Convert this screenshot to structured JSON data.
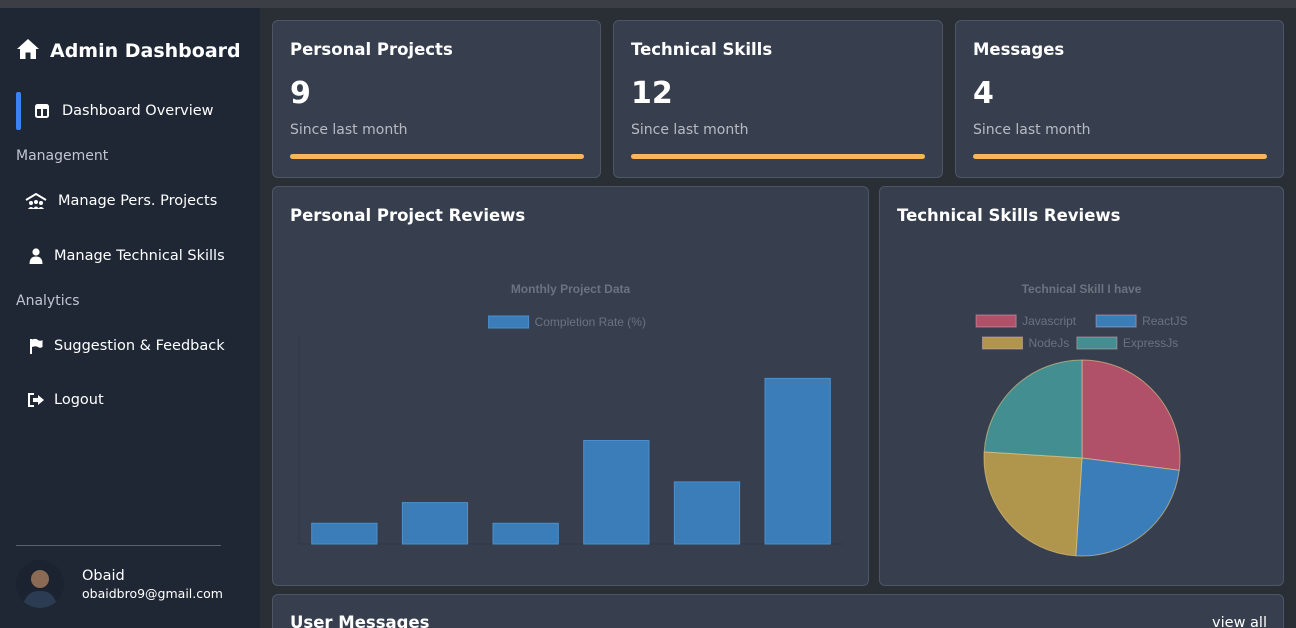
{
  "sidebar": {
    "title": "Admin Dashboard",
    "items": [
      {
        "label": "Dashboard Overview"
      },
      {
        "label": "Manage Pers. Projects"
      },
      {
        "label": "Manage Technical Skills"
      },
      {
        "label": "Suggestion & Feedback"
      },
      {
        "label": "Logout"
      }
    ],
    "sections": {
      "management": "Management",
      "analytics": "Analytics"
    },
    "user": {
      "name": "Obaid",
      "email": "obaidbro9@gmail.com"
    }
  },
  "stats": [
    {
      "title": "Personal Projects",
      "value": "9",
      "subtitle": "Since last month",
      "progress": 1.0
    },
    {
      "title": "Technical Skills",
      "value": "12",
      "subtitle": "Since last month",
      "progress": 1.0
    },
    {
      "title": "Messages",
      "value": "4",
      "subtitle": "Since last month",
      "progress": 1.0
    }
  ],
  "colors": {
    "accent": "#3b82f6",
    "progress": "#f8b55a",
    "bar": "#3a7db8"
  },
  "panels": {
    "project_reviews": {
      "title": "Personal Project Reviews"
    },
    "skill_reviews": {
      "title": "Technical Skills Reviews"
    },
    "messages": {
      "title": "User Messages",
      "view_all": "view all"
    }
  },
  "chart_data": [
    {
      "type": "bar",
      "title": "Monthly Project Data",
      "categories": [
        "",
        "",
        "",
        "",
        "",
        ""
      ],
      "series": [
        {
          "name": "Completion Rate (%)",
          "values": [
            10,
            20,
            10,
            50,
            30,
            80
          ]
        }
      ],
      "ylim": [
        0,
        100
      ],
      "grid": false,
      "legend": "top"
    },
    {
      "type": "pie",
      "title": "Technical Skill I have",
      "labels": [
        "Javascript",
        "ReactJS",
        "NodeJs",
        "ExpressJs"
      ],
      "values": [
        27,
        24,
        25,
        24
      ],
      "colors": [
        "#b05069",
        "#3a7db8",
        "#b0954d",
        "#438e90"
      ],
      "legend": "top"
    }
  ]
}
